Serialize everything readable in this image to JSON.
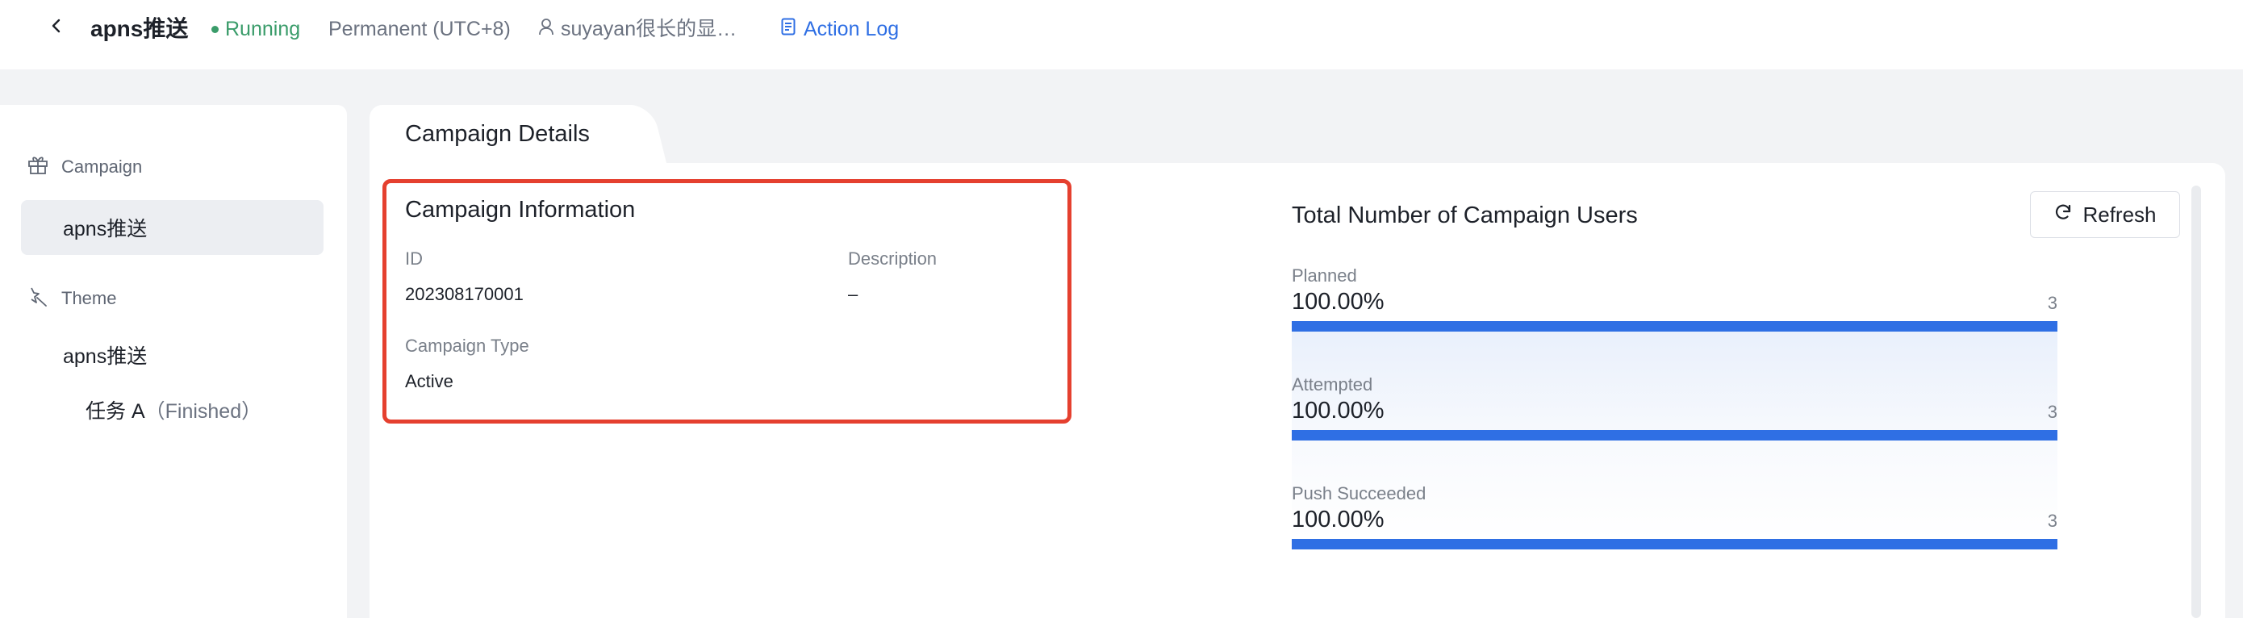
{
  "header": {
    "back_icon": "chevron-left-icon",
    "campaign_name": "apns推送",
    "status": "Running",
    "status_color": "#3a9c6a",
    "schedule": "Permanent (UTC+8)",
    "owner_icon": "user-icon",
    "owner": "suyayan很长的显…",
    "action_log_icon": "document-icon",
    "action_log": "Action Log",
    "accent_color": "#2f6fe4"
  },
  "sidebar": {
    "campaign_section": {
      "icon": "gift-icon",
      "label": "Campaign"
    },
    "campaign_item": "apns推送",
    "theme_section": {
      "icon": "magic-wand-icon",
      "label": "Theme"
    },
    "theme_item": "apns推送",
    "task": {
      "name": "任务 A",
      "status": "（Finished）"
    }
  },
  "tabs": [
    {
      "label": "Campaign Details",
      "active": true
    }
  ],
  "campaign_info": {
    "title": "Campaign Information",
    "id_label": "ID",
    "id_value": "202308170001",
    "description_label": "Description",
    "description_value": "–",
    "type_label": "Campaign Type",
    "type_value": "Active",
    "highlight_color": "#e5402f"
  },
  "stats": {
    "title": "Total Number of Campaign Users",
    "refresh_icon": "refresh-icon",
    "refresh_label": "Refresh",
    "metrics": [
      {
        "label": "Planned",
        "percent_text": "100.00%",
        "percent": 100,
        "count": "3"
      },
      {
        "label": "Attempted",
        "percent_text": "100.00%",
        "percent": 100,
        "count": "3"
      },
      {
        "label": "Push Succeeded",
        "percent_text": "100.00%",
        "percent": 100,
        "count": "3"
      }
    ]
  }
}
